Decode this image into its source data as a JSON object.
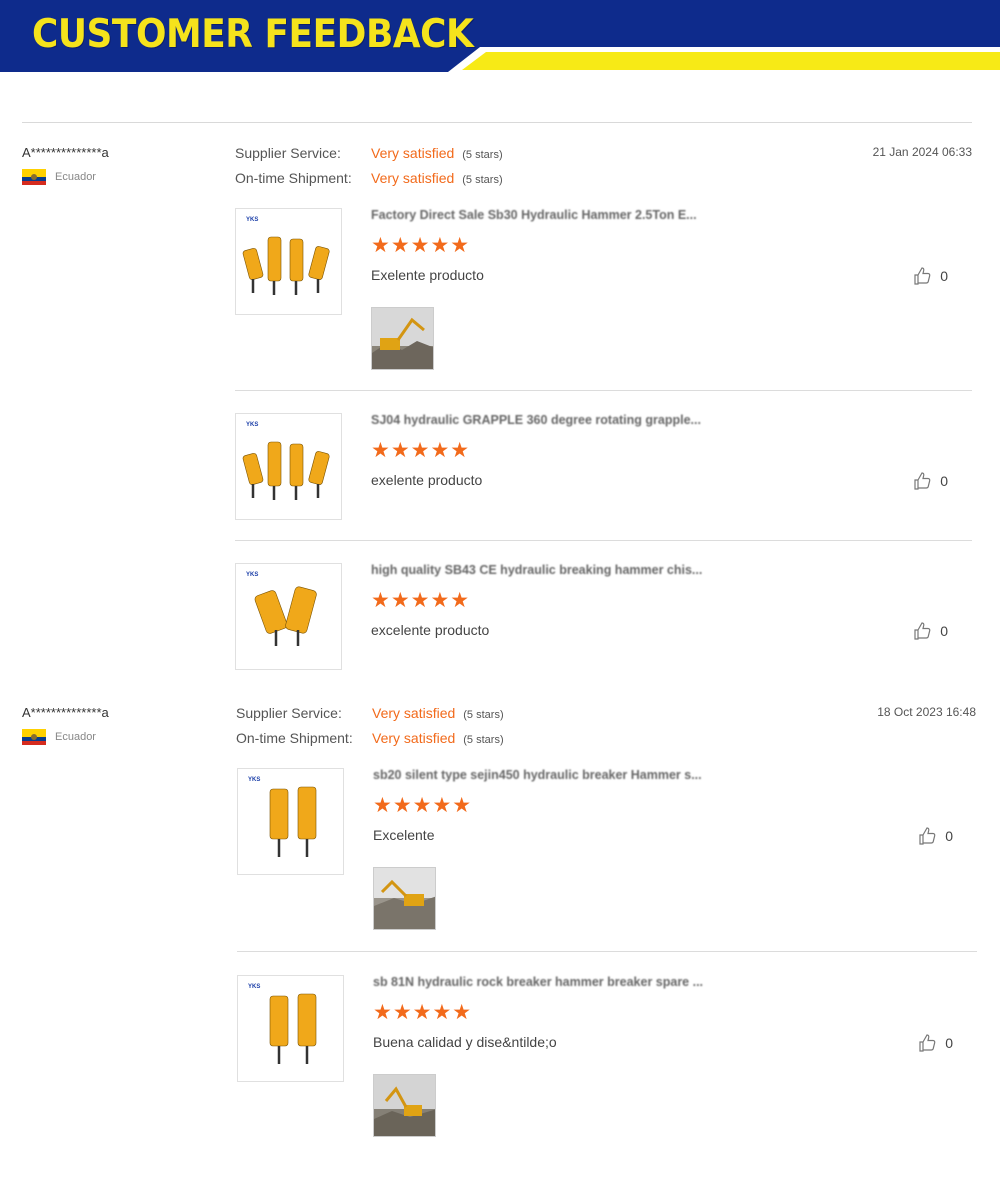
{
  "banner": {
    "title": "CUSTOMER FEEDBACK"
  },
  "colors": {
    "banner_blue": "#0e2b8c",
    "banner_yellow": "#f5e31c",
    "accent_orange": "#f26a1b"
  },
  "reviews": [
    {
      "buyer": "A**************a",
      "country": "Ecuador",
      "date": "21 Jan 2024 06:33",
      "ratings": [
        {
          "label": "Supplier Service:",
          "value": "Very satisfied",
          "stars": "(5 stars)"
        },
        {
          "label": "On-time Shipment:",
          "value": "Very satisfied",
          "stars": "(5 stars)"
        }
      ],
      "products": [
        {
          "title": "Factory Direct Sale Sb30 Hydraulic Hammer 2.5Ton E...",
          "stars": "★★★★★",
          "comment": "Exelente producto",
          "likes": "0",
          "has_photo": true,
          "thumb_logo": "YKS"
        },
        {
          "title": "SJ04 hydraulic GRAPPLE 360 degree rotating grapple...",
          "stars": "★★★★★",
          "comment": "exelente producto",
          "likes": "0",
          "has_photo": false,
          "thumb_logo": "YKS"
        },
        {
          "title": "high quality SB43 CE hydraulic breaking hammer chis...",
          "stars": "★★★★★",
          "comment": "excelente producto",
          "likes": "0",
          "has_photo": false,
          "thumb_logo": "YKS"
        }
      ]
    },
    {
      "buyer": "A**************a",
      "country": "Ecuador",
      "date": "18 Oct 2023 16:48",
      "ratings": [
        {
          "label": "Supplier Service:",
          "value": "Very satisfied",
          "stars": "(5 stars)"
        },
        {
          "label": "On-time Shipment:",
          "value": "Very satisfied",
          "stars": "(5 stars)"
        }
      ],
      "products": [
        {
          "title": "sb20 silent type sejin450 hydraulic breaker Hammer s...",
          "stars": "★★★★★",
          "comment": "Excelente",
          "likes": "0",
          "has_photo": true,
          "thumb_logo": "YKS"
        },
        {
          "title": "sb 81N hydraulic rock breaker hammer breaker spare ...",
          "stars": "★★★★★",
          "comment": "Buena calidad y dise&ntilde;o",
          "likes": "0",
          "has_photo": true,
          "thumb_logo": "YKS"
        }
      ]
    }
  ]
}
